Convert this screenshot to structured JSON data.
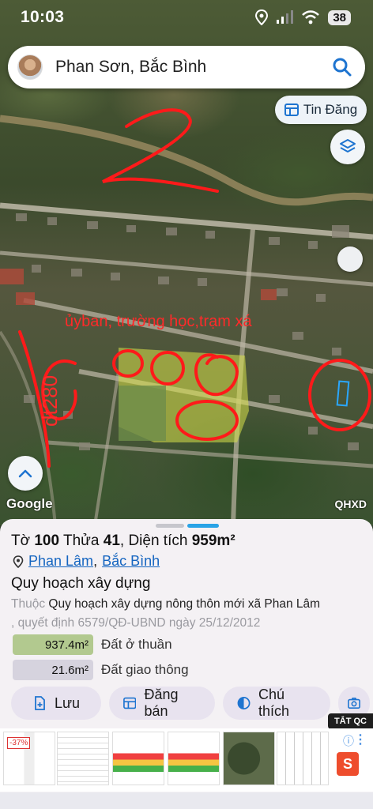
{
  "status": {
    "time": "10:03",
    "battery": "38"
  },
  "search": {
    "query": "Phan Sơn, Bắc Bình"
  },
  "map": {
    "tin_dang_label": "Tin Đăng",
    "annotation_text": "ủyban, trường học,trạm xá",
    "annotation_vertical": "dt280",
    "annotation_number": "2",
    "google_label": "Google",
    "qhxd_label": "QHXD"
  },
  "sheet": {
    "parcel": {
      "to_label": "Tờ",
      "to_value": "100",
      "thua_label": "Thửa",
      "thua_value": "41",
      "area_label": "Diện tích",
      "area_value": "959m²"
    },
    "location": {
      "commune": "Phan Lâm",
      "separator": ",",
      "district": "Bắc Bình"
    },
    "plan_title": "Quy hoạch xây dựng",
    "plan_desc_prefix": "Thuộc",
    "plan_desc_main": "Quy hoạch xây dựng nông thôn mới xã Phan Lâm",
    "plan_desc_suffix": ", quyết định 6579/QĐ-UBND ngày 25/12/2012",
    "land_uses": [
      {
        "area": "937.4m²",
        "label": "Đất ở thuần",
        "color": "#b2c98f"
      },
      {
        "area": "21.6m²",
        "label": "Đất giao thông",
        "color": "#d6d3de"
      }
    ],
    "actions": [
      "Lưu",
      "Đăng bán",
      "Chú thích"
    ]
  },
  "ads": {
    "tat_qc": "TẮT QC",
    "discount": "-37%",
    "info": "ⓘ",
    "more": "⋮",
    "shopee": "S"
  }
}
